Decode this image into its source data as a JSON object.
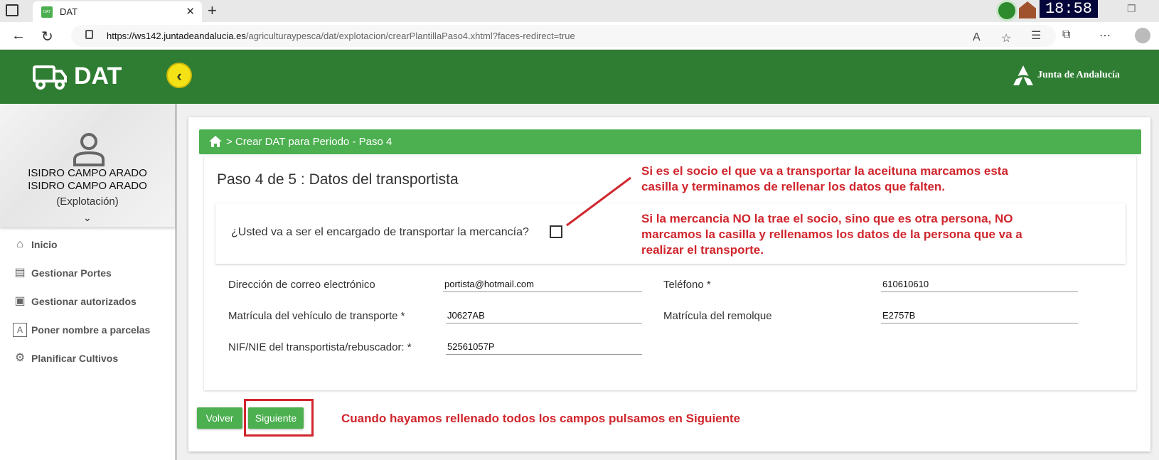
{
  "browser": {
    "tab_title": "DAT",
    "tab_favicon_text": "DAT",
    "url_host": "https://ws142.juntadeandalucia.es",
    "url_path": "/agriculturaypesca/dat/explotacion/crearPlantillaPaso4.xhtml?faces-redirect=true",
    "clock": "18:58"
  },
  "header": {
    "title": "DAT",
    "brand": "Junta de Andalucía"
  },
  "profile": {
    "name_line1": "ISIDRO CAMPO ARADO",
    "name_line2": "ISIDRO CAMPO ARADO",
    "role": "(Explotación)"
  },
  "sidebar": {
    "items": [
      {
        "label": "Inicio",
        "icon": "home-icon"
      },
      {
        "label": "Gestionar Portes",
        "icon": "clipboard-icon"
      },
      {
        "label": "Gestionar autorizados",
        "icon": "id-card-icon"
      },
      {
        "label": "Poner nombre a parcelas",
        "icon": "text-frame-icon"
      },
      {
        "label": "Planificar Cultivos",
        "icon": "tractor-icon"
      }
    ]
  },
  "breadcrumb": "> Crear DAT para Periodo - Paso 4",
  "form": {
    "step_title": "Paso 4 de 5 : Datos del transportista",
    "question": "¿Usted va a ser el encargado de transportar la mercancía?",
    "question_checked": false,
    "fields": {
      "email": {
        "label": "Dirección de correo electrónico",
        "value": "portista@hotmail.com"
      },
      "telefono": {
        "label": "Teléfono",
        "required": "*",
        "value": "610610610"
      },
      "matricula": {
        "label": "Matrícula del vehículo de transporte",
        "required": "*",
        "value": "J0627AB"
      },
      "remolque": {
        "label": "Matrícula del remolque",
        "value": "E2757B"
      },
      "nif": {
        "label": "NIF/NIE del transportista/rebuscador:",
        "required": "*",
        "value": "52561057P"
      }
    }
  },
  "buttons": {
    "back": "Volver",
    "next": "Siguiente"
  },
  "annotations": {
    "note1_line1": "Si es el socio el que va a transportar la aceituna marcamos esta",
    "note1_line2": "casilla y terminamos de rellenar los datos que falten.",
    "note2_line1": "Si la mercancia NO la trae el socio, sino que es otra persona, NO",
    "note2_line2": "marcamos la casilla y rellenamos los datos de la persona que va a",
    "note2_line3": "realizar el transporte.",
    "note3": "Cuando hayamos rellenado todos los campos pulsamos en Siguiente",
    "color": "#d0262d"
  },
  "colors": {
    "header_green": "#2e7d32",
    "accent_green": "#4caf50",
    "collapse_yellow": "#f5e216"
  }
}
